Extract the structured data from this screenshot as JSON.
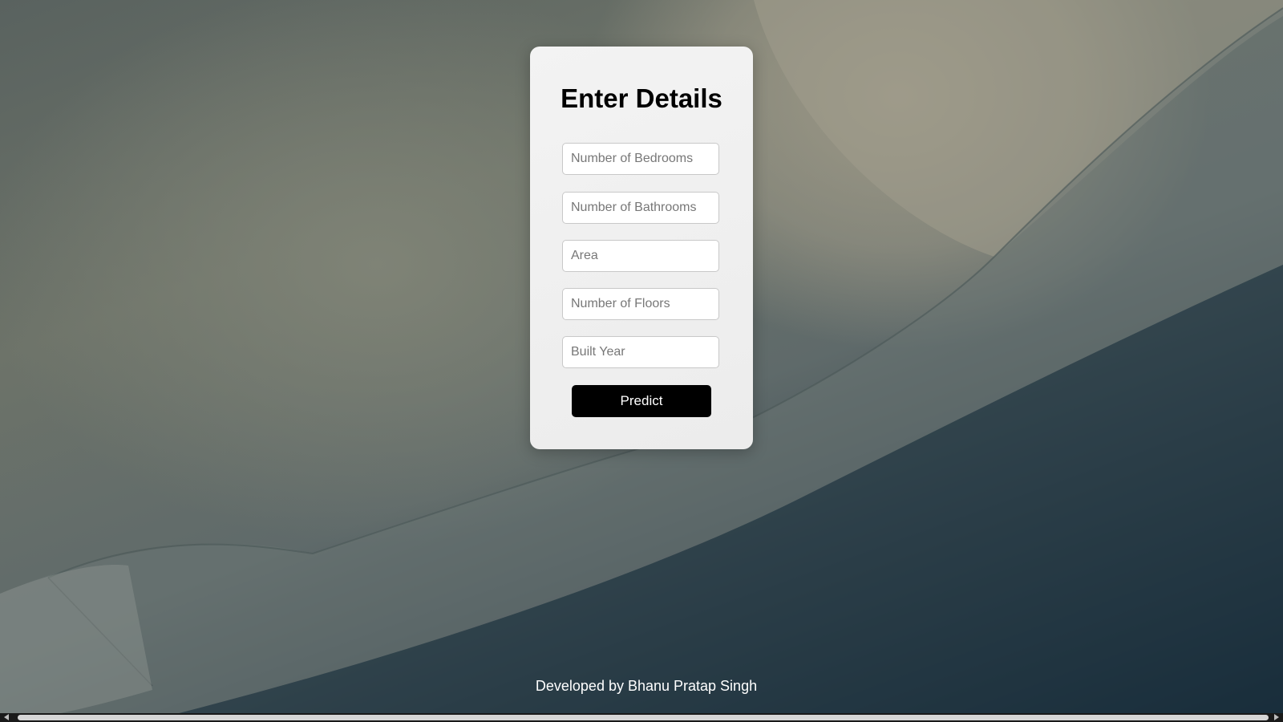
{
  "form": {
    "title": "Enter Details",
    "fields": [
      {
        "placeholder": "Number of Bedrooms"
      },
      {
        "placeholder": "Number of Bathrooms"
      },
      {
        "placeholder": "Area"
      },
      {
        "placeholder": "Number of Floors"
      },
      {
        "placeholder": "Built Year"
      }
    ],
    "submit_label": "Predict"
  },
  "footer": {
    "credit": "Developed by Bhanu Pratap Singh"
  },
  "colors": {
    "button_bg": "#000000",
    "card_bg": "#f0f0f0"
  }
}
